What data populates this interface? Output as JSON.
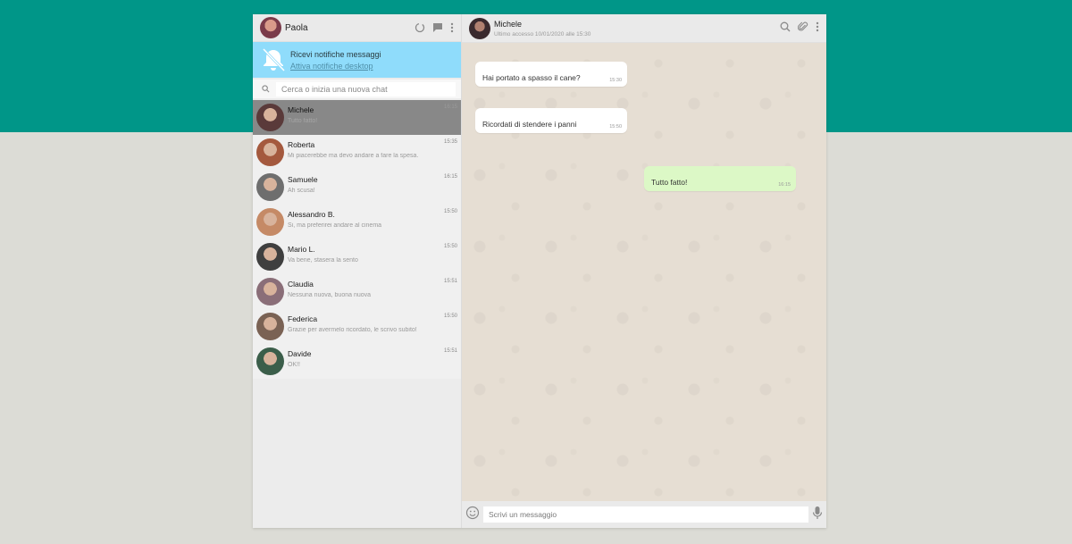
{
  "user": {
    "name": "Paola"
  },
  "notification": {
    "title": "Ricevi notifiche messaggi",
    "link": "Attiva notifiche desktop"
  },
  "search": {
    "placeholder": "Cerca o inizia una nuova chat"
  },
  "chats": [
    {
      "name": "Michele",
      "last": "Tutto fatto!",
      "time": "16:15",
      "active": true,
      "color": "#5a3a3a"
    },
    {
      "name": "Roberta",
      "last": "Mi piacerebbe ma devo andare a fare la spesa.",
      "time": "15:35",
      "active": false,
      "color": "#a4593e"
    },
    {
      "name": "Samuele",
      "last": "Ah scusa!",
      "time": "16:15",
      "active": false,
      "color": "#6e6e6e"
    },
    {
      "name": "Alessandro B.",
      "last": "Si, ma preferirei andare al cinema",
      "time": "15:50",
      "active": false,
      "color": "#c58a66"
    },
    {
      "name": "Mario L.",
      "last": "Va bene, stasera la sento",
      "time": "15:50",
      "active": false,
      "color": "#3f3f3f"
    },
    {
      "name": "Claudia",
      "last": "Nessuna nuova, buona nuova",
      "time": "15:51",
      "active": false,
      "color": "#8a6e78"
    },
    {
      "name": "Federica",
      "last": "Grazie per avermelo ricordato, le scrivo subito!",
      "time": "15:50",
      "active": false,
      "color": "#7a6254"
    },
    {
      "name": "Davide",
      "last": "OK!!",
      "time": "15:51",
      "active": false,
      "color": "#3b5e4a"
    }
  ],
  "chat": {
    "contact": "Michele",
    "status": "Ultimo accesso 10/01/2020 alle 15:30",
    "messages": [
      {
        "text": "Hai portato a spasso il cane?",
        "time": "15:30",
        "dir": "in"
      },
      {
        "text": "Ricordati di stendere i panni",
        "time": "15:50",
        "dir": "in"
      },
      {
        "text": "Tutto fatto!",
        "time": "16:15",
        "dir": "out"
      }
    ]
  },
  "composer": {
    "placeholder": "Scrivi un messaggio"
  },
  "colors": {
    "brand": "#009688",
    "background": "#dcdcd6",
    "notify_bg": "#8fdcfb",
    "active_chat": "#888888",
    "outgoing_bubble": "#dcf8c6",
    "incoming_bubble": "#ffffff"
  },
  "icons": {
    "header": [
      "status-icon",
      "new-chat-icon",
      "menu-icon"
    ],
    "chat_header": [
      "search-icon",
      "attach-icon",
      "menu-icon"
    ],
    "composer": [
      "emoji-icon",
      "mic-icon"
    ],
    "notification": "bell-off-icon"
  }
}
